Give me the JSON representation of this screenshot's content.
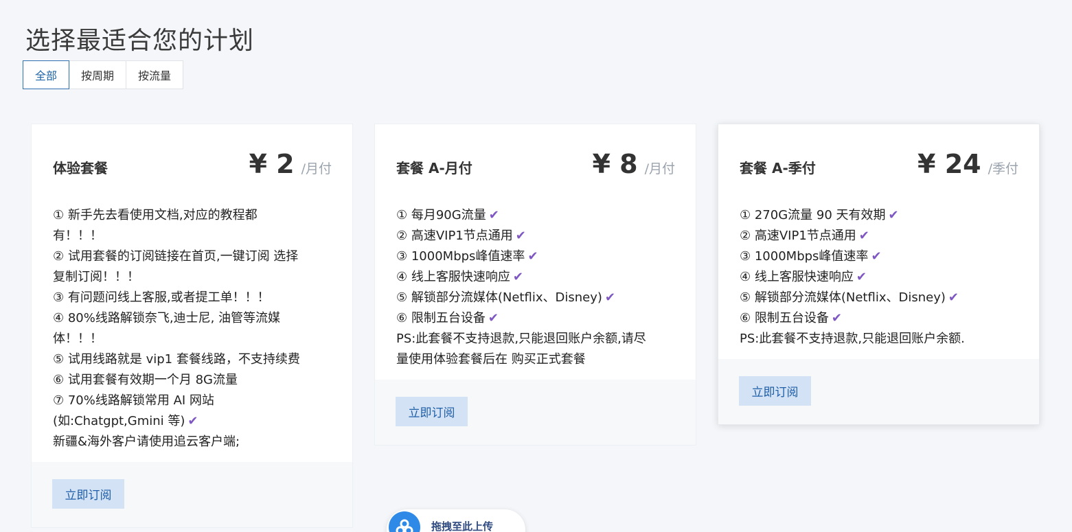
{
  "page": {
    "title": "选择最适合您的计划"
  },
  "tabs": [
    {
      "label": "全部",
      "active": true
    },
    {
      "label": "按周期",
      "active": false
    },
    {
      "label": "按流量",
      "active": false
    }
  ],
  "plans": [
    {
      "name": "体验套餐",
      "price": "¥ 2",
      "period": "/月付",
      "lines": [
        "① 新手先去看使用文档,对应的教程都",
        "有！！！",
        "② 试用套餐的订阅链接在首页,一键订阅 选择",
        "复制订阅！！！",
        "③ 有问题问线上客服,或者提工单！！！",
        "④ 80%线路解锁奈飞,迪士尼, 油管等流媒",
        "体！！！",
        "⑤ 试用线路就是 vip1 套餐线路，不支持续费",
        "⑥ 试用套餐有效期一个月 8G流量",
        "⑦ 70%线路解锁常用 AI 网站",
        "(如:Chatgpt,Gmini 等)",
        "新疆&海外客户请使用追云客户端;"
      ],
      "checks": [
        false,
        false,
        false,
        false,
        false,
        false,
        false,
        false,
        false,
        false,
        true,
        false
      ],
      "button": "立即订阅"
    },
    {
      "name": "套餐 A-月付",
      "price": "¥ 8",
      "period": "/月付",
      "lines": [
        "① 每月90G流量",
        "② 高速VIP1节点通用",
        "③ 1000Mbps峰值速率",
        "④ 线上客服快速响应",
        "⑤ 解锁部分流媒体(Netflix、Disney)",
        "⑥ 限制五台设备",
        "PS:此套餐不支持退款,只能退回账户余额,请尽",
        "量使用体验套餐后在 购买正式套餐"
      ],
      "checks": [
        true,
        true,
        true,
        true,
        true,
        true,
        false,
        false
      ],
      "button": "立即订阅"
    },
    {
      "name": "套餐 A-季付",
      "price": "¥ 24",
      "period": "/季付",
      "lines": [
        "① 270G流量 90 天有效期",
        "② 高速VIP1节点通用",
        "③ 1000Mbps峰值速率",
        "④ 线上客服快速响应",
        "⑤ 解锁部分流媒体(Netflix、Disney)",
        "⑥ 限制五台设备",
        "PS:此套餐不支持退款,只能退回账户余额."
      ],
      "checks": [
        true,
        true,
        true,
        true,
        true,
        true,
        false
      ],
      "button": "立即订阅"
    }
  ],
  "upload": {
    "label": "拖拽至此上传",
    "icon": "cloud-upload-icon"
  },
  "colors": {
    "accent": "#1f64a6",
    "button_bg": "#d3e2f4",
    "check": "#7e57c2"
  }
}
